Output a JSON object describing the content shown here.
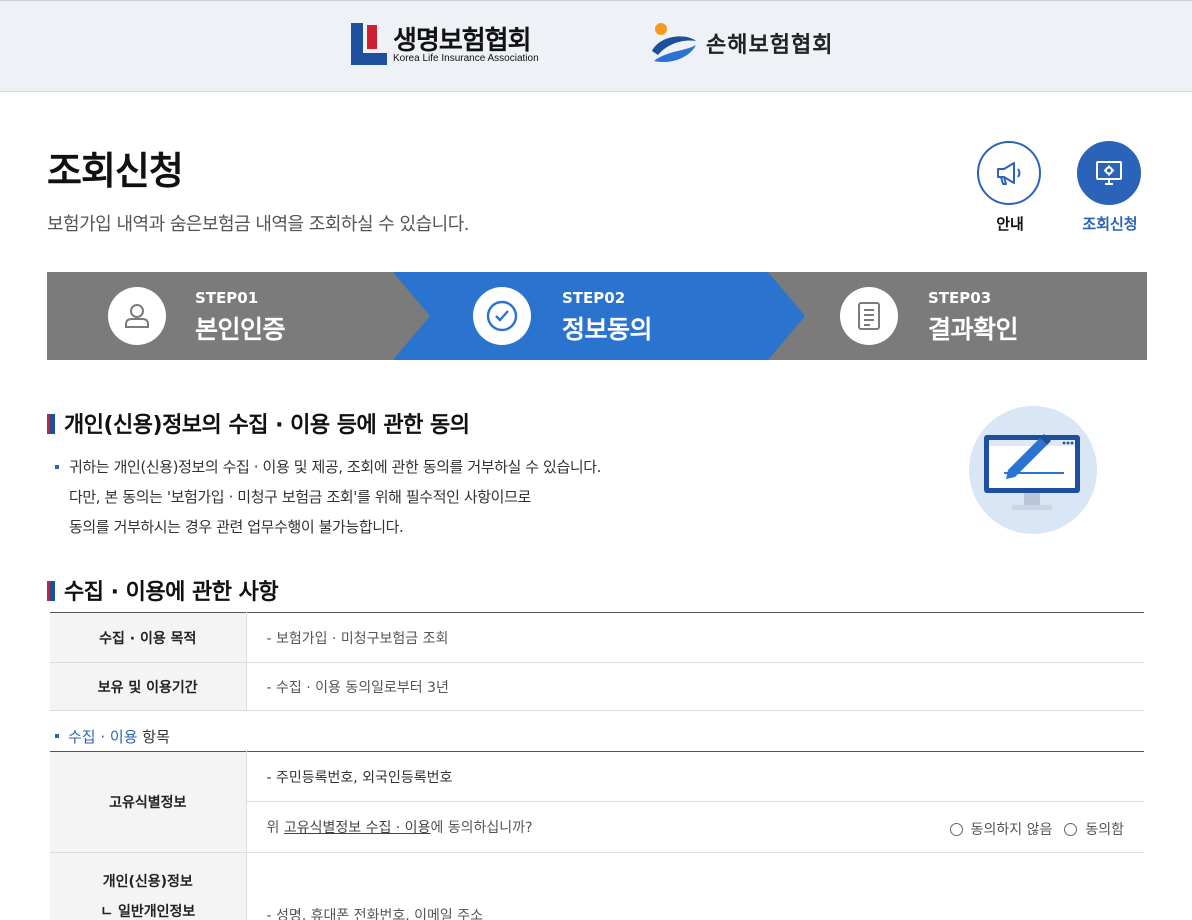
{
  "header": {
    "life_logo_ko": "생명보험협회",
    "life_logo_en": "Korea Life Insurance Association",
    "nonlife_logo_ko": "손해보험협회"
  },
  "page": {
    "title": "조회신청",
    "description": "보험가입 내역과 숨은보험금 내역을 조회하실 수 있습니다."
  },
  "quick_menu": {
    "guide": {
      "label": "안내",
      "icon": "megaphone-icon"
    },
    "inquiry": {
      "label": "조회신청",
      "icon": "monitor-icon"
    }
  },
  "steps": [
    {
      "num": "STEP01",
      "name": "본인인증",
      "icon": "user-icon",
      "active": false
    },
    {
      "num": "STEP02",
      "name": "정보동의",
      "icon": "check-circle-icon",
      "active": true
    },
    {
      "num": "STEP03",
      "name": "결과확인",
      "icon": "document-icon",
      "active": false
    }
  ],
  "consent_section": {
    "title": "개인(신용)정보의 수집 · 이용 등에 관한 동의",
    "lines": [
      "귀하는 개인(신용)정보의 수집 · 이용 및 제공, 조회에 관한 동의를 거부하실 수 있습니다.",
      "다만, 본 동의는 '보험가입 · 미청구 보험금 조회'를 위해 필수적인 사항이므로",
      "동의를 거부하시는 경우 관련 업무수행이 불가능합니다."
    ]
  },
  "usage_section": {
    "title": "수집 · 이용에 관한 사항",
    "rows": [
      {
        "label": "수집 · 이용 목적",
        "value": "- 보험가입 · 미청구보험금 조회"
      },
      {
        "label": "보유 및 이용기간",
        "value": "- 수집 · 이용 동의일로부터 3년"
      }
    ],
    "items_heading_blue": "수집 · 이용",
    "items_heading_rest": " 항목",
    "unique_id": {
      "label": "고유식별정보",
      "value": "- 주민등록번호, 외국인등록번호",
      "question_prefix": "위 ",
      "question_link": "고유식별정보 수집 · 이용",
      "question_suffix": "에 동의하십니까?",
      "option_disagree": "동의하지 않음",
      "option_agree": "동의함"
    },
    "personal_info": {
      "label": "개인(신용)정보",
      "sub_label": "ㄴ 일반개인정보",
      "value": "- 성명, 휴대폰 전화번호, 이메일 주소"
    }
  },
  "colors": {
    "primary_blue": "#2a73cf",
    "step_gray": "#7b7b7b",
    "brand_red": "#cf2032",
    "brand_navy": "#1d4f9c"
  }
}
